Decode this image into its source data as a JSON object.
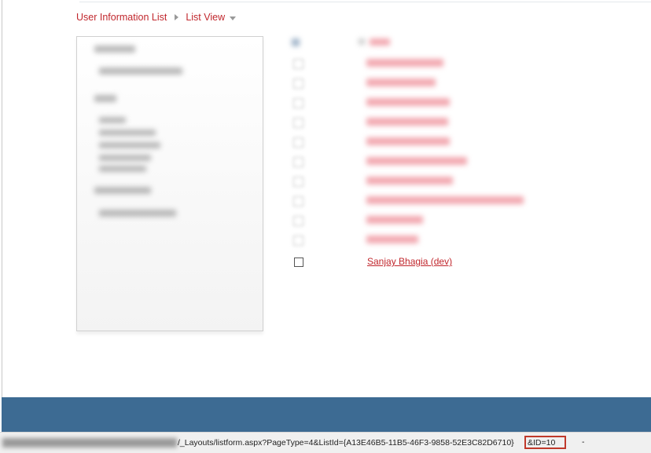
{
  "breadcrumb": {
    "list_title": "User Information List",
    "view_label": "List View"
  },
  "list": {
    "visible_item": "Sanjay Bhagia (dev)"
  },
  "statusbar": {
    "url_path": "/_Layouts/listform.aspx?PageType=4&ListId={A13E46B5-11B5-46F3-9858-52E3C82D6710}",
    "id_param": "&ID=10",
    "zone_text": "-"
  },
  "colors": {
    "link_red": "#c1272d",
    "footer_blue": "#3d6b93",
    "highlight_red": "#c0392b"
  }
}
